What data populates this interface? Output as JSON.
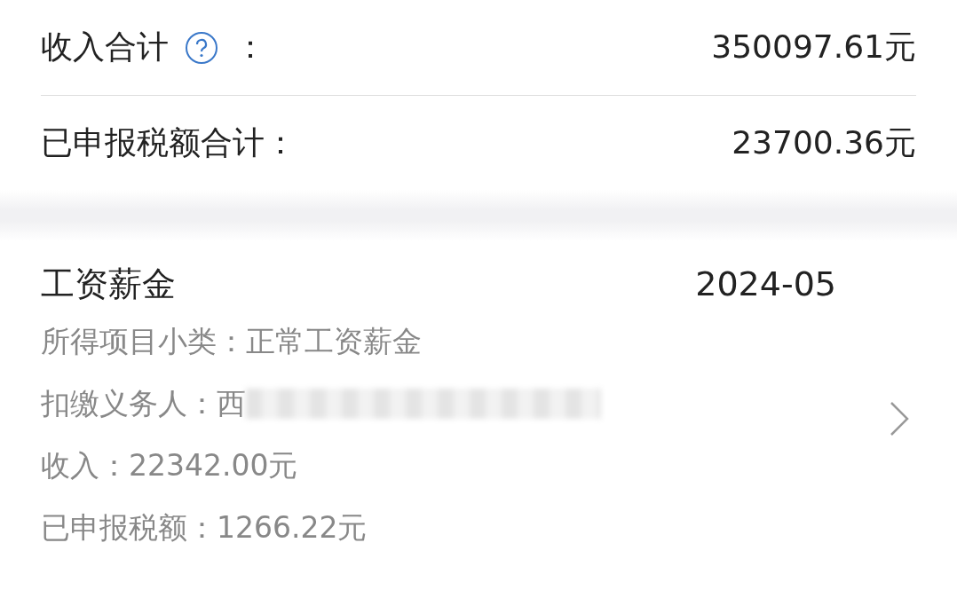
{
  "summary": {
    "rows": [
      {
        "label": "收入合计",
        "help": true,
        "colon": "：",
        "value": "350097.61元"
      },
      {
        "label": "已申报税额合计：",
        "help": false,
        "colon": "",
        "value": "23700.36元"
      }
    ]
  },
  "record": {
    "title": "工资薪金",
    "period": "2024-05",
    "details": [
      {
        "kind": "text",
        "text": "所得项目小类：正常工资薪金"
      },
      {
        "kind": "redacted",
        "text": "扣缴义务人：西"
      },
      {
        "kind": "text",
        "text": "收入：22342.00元"
      },
      {
        "kind": "text",
        "text": "已申报税额：1266.22元"
      }
    ]
  }
}
